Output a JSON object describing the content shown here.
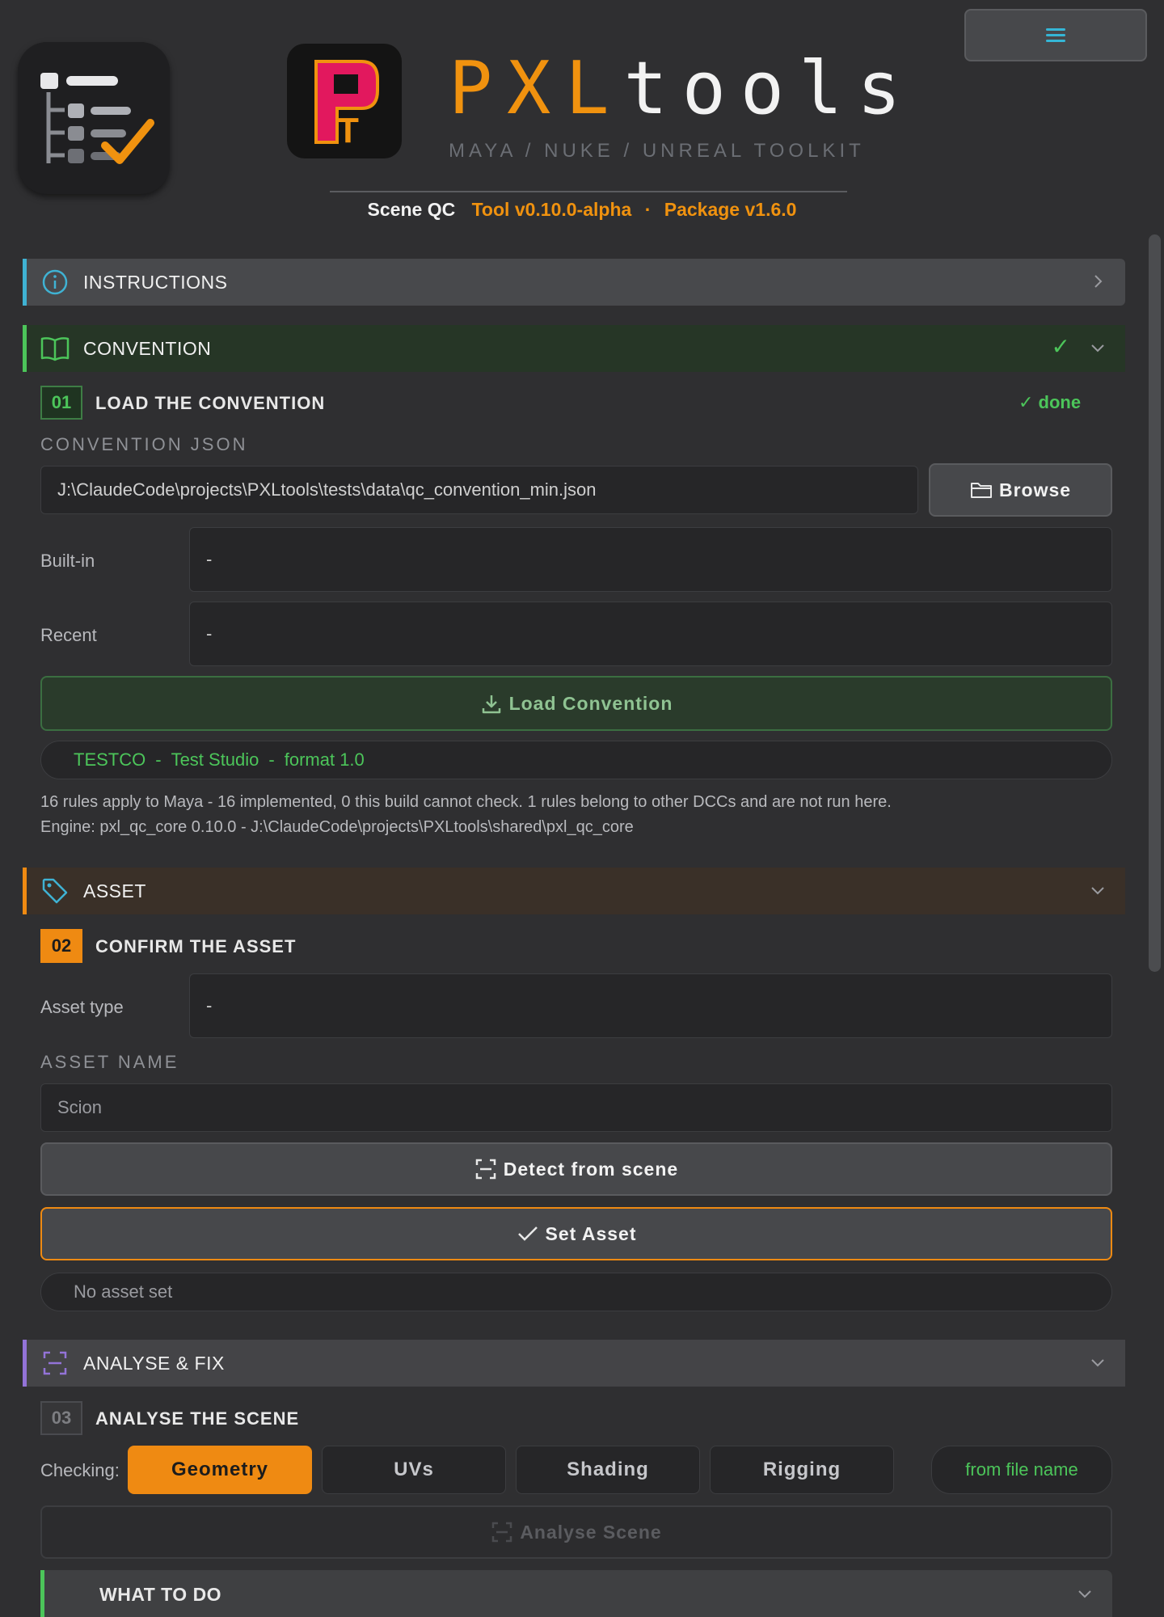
{
  "header": {
    "brand_a": "PXL",
    "brand_b": "tools",
    "tagline": "MAYA / NUKE / UNREAL TOOLKIT",
    "logo_letter_a": "P",
    "logo_letter_b": "T",
    "tool_name": "Scene QC",
    "tool_version": "Tool v0.10.0-alpha",
    "separator": "·",
    "package_version": "Package v1.6.0"
  },
  "sections": {
    "instructions": {
      "title": "INSTRUCTIONS"
    },
    "convention": {
      "title": "CONVENTION",
      "status": "✓"
    },
    "asset": {
      "title": "ASSET"
    },
    "analyse": {
      "title": "ANALYSE & FIX"
    }
  },
  "step1": {
    "number": "01",
    "title": "LOAD THE CONVENTION",
    "status": "✓ done",
    "json_label": "CONVENTION JSON",
    "json_path": "J:\\ClaudeCode\\projects\\PXLtools\\tests\\data\\qc_convention_min.json",
    "browse_label": "Browse",
    "builtin_label": "Built-in",
    "builtin_value": "-",
    "recent_label": "Recent",
    "recent_value": "-",
    "load_label": "Load Convention",
    "convention_code": "TESTCO",
    "sep": "-",
    "convention_studio": "Test Studio",
    "convention_format": "format 1.0",
    "info_line1": "16 rules apply to Maya - 16 implemented, 0 this build cannot check. 1 rules belong to other DCCs and are not run here.",
    "info_line2": "Engine: pxl_qc_core 0.10.0  -  J:\\ClaudeCode\\projects\\PXLtools\\shared\\pxl_qc_core"
  },
  "step2": {
    "number": "02",
    "title": "CONFIRM THE ASSET",
    "asset_type_label": "Asset type",
    "asset_type_value": "-",
    "asset_name_label": "ASSET NAME",
    "asset_name_value": "Scion",
    "detect_label": "Detect from scene",
    "set_label": "Set Asset",
    "status": "No asset set"
  },
  "step3": {
    "number": "03",
    "title": "ANALYSE THE SCENE",
    "checking_label": "Checking:",
    "categories": [
      "Geometry",
      "UVs",
      "Shading",
      "Rigging"
    ],
    "active_category": "Geometry",
    "source_label": "from file name",
    "analyse_label": "Analyse Scene",
    "what_to_do": "WHAT TO DO"
  },
  "colors": {
    "accent_orange": "#ef8a12",
    "accent_green": "#4cc55a",
    "accent_cyan": "#3fb2d3",
    "accent_purple": "#9373d8",
    "logo_magenta": "#e2185e"
  },
  "icons": {
    "menu": "hamburger-icon",
    "app": "checklist-icon",
    "instructions": "info-icon",
    "convention": "book-icon",
    "asset": "tag-icon",
    "analyse": "scan-icon",
    "browse": "folder-icon",
    "load": "download-icon",
    "detect": "scan-icon",
    "set": "check-icon"
  }
}
